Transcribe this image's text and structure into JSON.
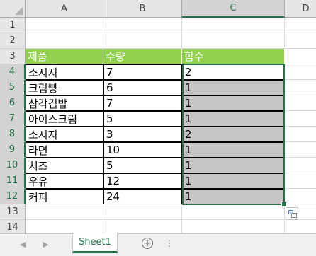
{
  "columns": [
    "A",
    "B",
    "C",
    "D"
  ],
  "rows": [
    "1",
    "2",
    "3",
    "4",
    "5",
    "6",
    "7",
    "8",
    "9",
    "10",
    "11",
    "12",
    "13",
    "14"
  ],
  "table": {
    "headers": [
      "제품",
      "수량",
      "함수"
    ],
    "data": [
      [
        "소시지",
        "7",
        "2"
      ],
      [
        "크림빵",
        "6",
        "1"
      ],
      [
        "삼각김밥",
        "7",
        "1"
      ],
      [
        "아이스크림",
        "5",
        "1"
      ],
      [
        "소시지",
        "3",
        "2"
      ],
      [
        "라면",
        "10",
        "1"
      ],
      [
        "치즈",
        "5",
        "1"
      ],
      [
        "우유",
        "12",
        "1"
      ],
      [
        "커피",
        "24",
        "1"
      ]
    ]
  },
  "selection": "C4:C12",
  "sheet_tab": "Sheet1",
  "colors": {
    "header_fill": "#92d050",
    "selection_accent": "#217346"
  }
}
